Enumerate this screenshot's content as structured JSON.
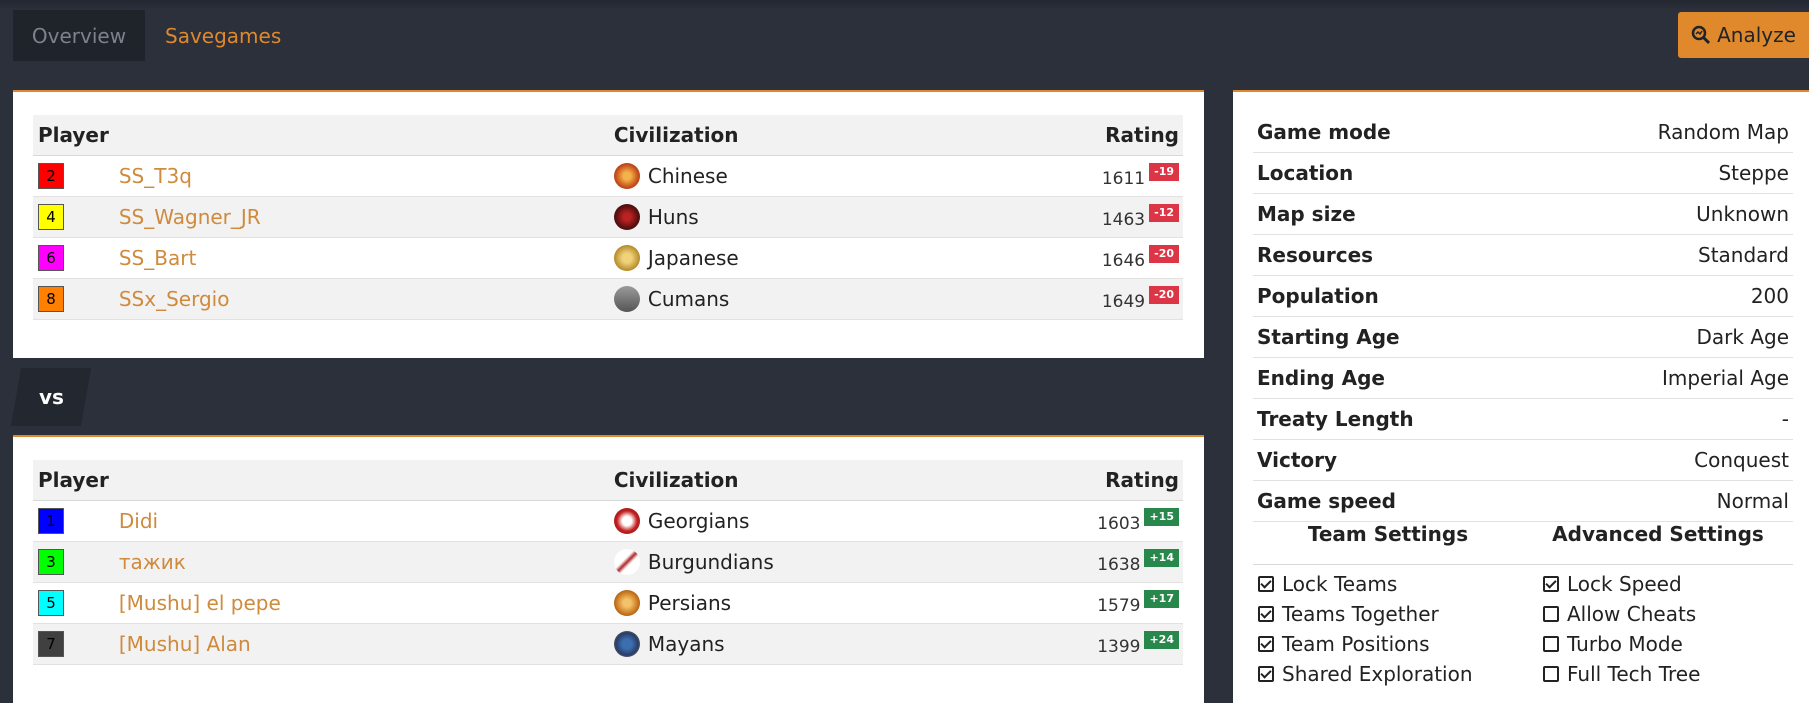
{
  "tabs": [
    {
      "label": "Overview",
      "active": false
    },
    {
      "label": "Savegames",
      "active": true
    }
  ],
  "analyze_label": "Analyze",
  "colors": {
    "accent": "#e0892c",
    "background": "#2b303b",
    "delta_negative": "#dc3545",
    "delta_positive": "#28874a"
  },
  "table_headers": {
    "player": "Player",
    "civilization": "Civilization",
    "rating": "Rating"
  },
  "vs_label": "vs",
  "team1": [
    {
      "number": "2",
      "color": "#ff0000",
      "name": "SS_T3q",
      "civ": "Chinese",
      "civ_icon": "chinese-emblem-icon",
      "rating": "1611",
      "delta": "-19"
    },
    {
      "number": "4",
      "color": "#ffff00",
      "name": "SS_Wagner_JR",
      "civ": "Huns",
      "civ_icon": "huns-emblem-icon",
      "rating": "1463",
      "delta": "-12"
    },
    {
      "number": "6",
      "color": "#ff00ff",
      "name": "SS_Bart",
      "civ": "Japanese",
      "civ_icon": "japanese-emblem-icon",
      "rating": "1646",
      "delta": "-20"
    },
    {
      "number": "8",
      "color": "#ff8000",
      "name": "SSx_Sergio",
      "civ": "Cumans",
      "civ_icon": "cumans-emblem-icon",
      "rating": "1649",
      "delta": "-20"
    }
  ],
  "team2": [
    {
      "number": "1",
      "color": "#0000ff",
      "name": "Didi",
      "civ": "Georgians",
      "civ_icon": "georgians-emblem-icon",
      "rating": "1603",
      "delta": "+15"
    },
    {
      "number": "3",
      "color": "#00ff00",
      "name": "тажик",
      "civ": "Burgundians",
      "civ_icon": "burgundians-emblem-icon",
      "rating": "1638",
      "delta": "+14"
    },
    {
      "number": "5",
      "color": "#00ffff",
      "name": "[Mushu] el pepe",
      "civ": "Persians",
      "civ_icon": "persians-emblem-icon",
      "rating": "1579",
      "delta": "+17"
    },
    {
      "number": "7",
      "color": "#404040",
      "name": "[Mushu] Alan",
      "civ": "Mayans",
      "civ_icon": "mayans-emblem-icon",
      "rating": "1399",
      "delta": "+24"
    }
  ],
  "settings": [
    {
      "label": "Game mode",
      "value": "Random Map"
    },
    {
      "label": "Location",
      "value": "Steppe"
    },
    {
      "label": "Map size",
      "value": "Unknown"
    },
    {
      "label": "Resources",
      "value": "Standard"
    },
    {
      "label": "Population",
      "value": "200"
    },
    {
      "label": "Starting Age",
      "value": "Dark Age"
    },
    {
      "label": "Ending Age",
      "value": "Imperial Age"
    },
    {
      "label": "Treaty Length",
      "value": "-"
    },
    {
      "label": "Victory",
      "value": "Conquest"
    },
    {
      "label": "Game speed",
      "value": "Normal"
    }
  ],
  "team_settings_title": "Team Settings",
  "advanced_settings_title": "Advanced Settings",
  "team_settings": [
    {
      "label": "Lock Teams",
      "checked": true
    },
    {
      "label": "Teams Together",
      "checked": true
    },
    {
      "label": "Team Positions",
      "checked": true
    },
    {
      "label": "Shared Exploration",
      "checked": true
    }
  ],
  "advanced_settings": [
    {
      "label": "Lock Speed",
      "checked": true
    },
    {
      "label": "Allow Cheats",
      "checked": false
    },
    {
      "label": "Turbo Mode",
      "checked": false
    },
    {
      "label": "Full Tech Tree",
      "checked": false
    }
  ]
}
